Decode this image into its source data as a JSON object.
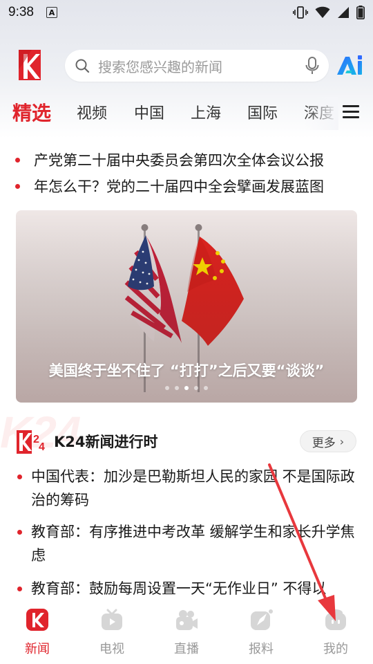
{
  "status_bar": {
    "time": "9:38",
    "icons": [
      "keyboard-a-icon",
      "vibrate-icon",
      "wifi-icon",
      "signal-icon",
      "battery-icon"
    ]
  },
  "header": {
    "search_placeholder": "搜索您感兴趣的新闻",
    "icons": [
      "app-logo",
      "search-icon",
      "microphone-icon",
      "ai-icon"
    ]
  },
  "tabs": [
    {
      "label": "精选",
      "active": true
    },
    {
      "label": "视频",
      "active": false
    },
    {
      "label": "中国",
      "active": false
    },
    {
      "label": "上海",
      "active": false
    },
    {
      "label": "国际",
      "active": false
    },
    {
      "label": "深度",
      "active": false
    }
  ],
  "headlines": [
    "产党第二十届中央委员会第四次全体会议公报",
    "年怎么干？党的二十届四中全会擘画发展蓝图"
  ],
  "banner": {
    "caption": "美国终于坐不住了 “打打”之后又要“谈谈”",
    "slide_count": 5,
    "active_slide": 3
  },
  "k24_section": {
    "watermark": "K24",
    "title": "K24新闻进行时",
    "more_label": "更多",
    "items": [
      "中国代表：加沙是巴勒斯坦人民的家园 不是国际政治的筹码",
      "教育部：有序推进中考改革 缓解学生和家长升学焦虑",
      "教育部：鼓励每周设置一天“无作业日” 不得以"
    ]
  },
  "bottom_nav": [
    {
      "label": "新闻",
      "icon": "news-icon",
      "active": true
    },
    {
      "label": "电视",
      "icon": "tv-icon",
      "active": false
    },
    {
      "label": "直播",
      "icon": "camera-icon",
      "active": false
    },
    {
      "label": "报料",
      "icon": "report-icon",
      "active": false
    },
    {
      "label": "我的",
      "icon": "profile-icon",
      "active": false
    }
  ],
  "colors": {
    "accent": "#e0242c",
    "inactive": "#999999",
    "annotation_arrow": "#e8383d"
  }
}
